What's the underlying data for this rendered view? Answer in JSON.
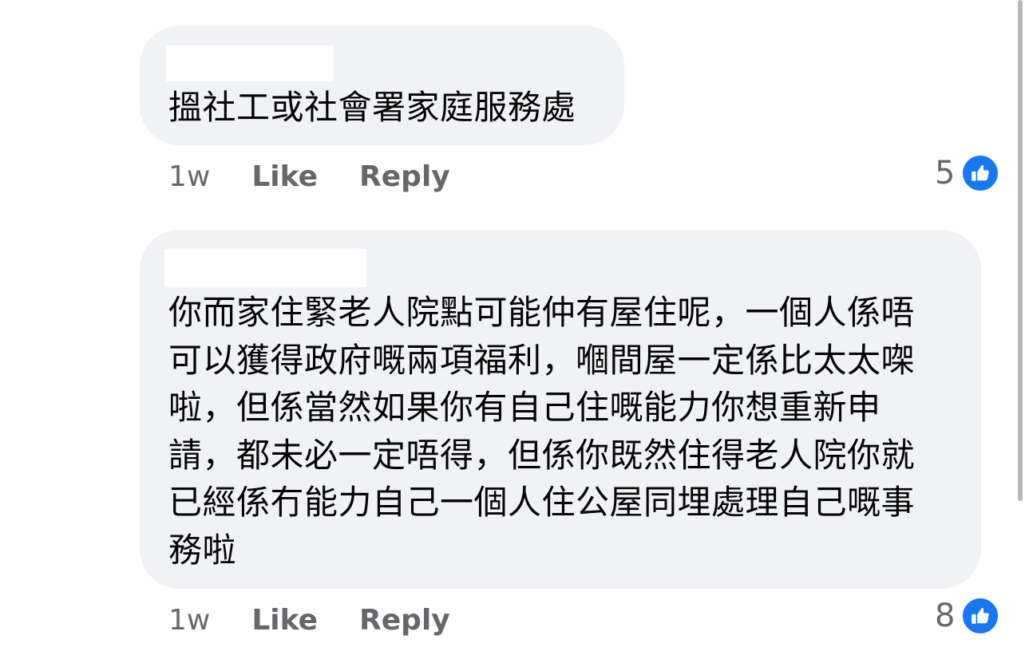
{
  "comments": [
    {
      "text": "搵社工或社會署家庭服務處",
      "time": "1w",
      "like_label": "Like",
      "reply_label": "Reply",
      "reaction_count": "5",
      "reaction_icon": "thumbs-up-icon"
    },
    {
      "text": "你而家住緊老人院點可能仲有屋住呢，一個人係唔\n可以獲得政府嘅兩項福利，嗰間屋一定係比太太㗎\n啦，但係當然如果你有自己住嘅能力你想重新申\n請，都未必一定唔得，但係你既然住得老人院你就\n已經係冇能力自己一個人住公屋同埋處理自己嘅事\n務啦",
      "time": "1w",
      "like_label": "Like",
      "reply_label": "Reply",
      "reaction_count": "8",
      "reaction_icon": "thumbs-up-icon"
    }
  ],
  "colors": {
    "bubble": "#f0f2f5",
    "text": "#050505",
    "meta": "#65676b",
    "like_blue": "#1877f2"
  }
}
